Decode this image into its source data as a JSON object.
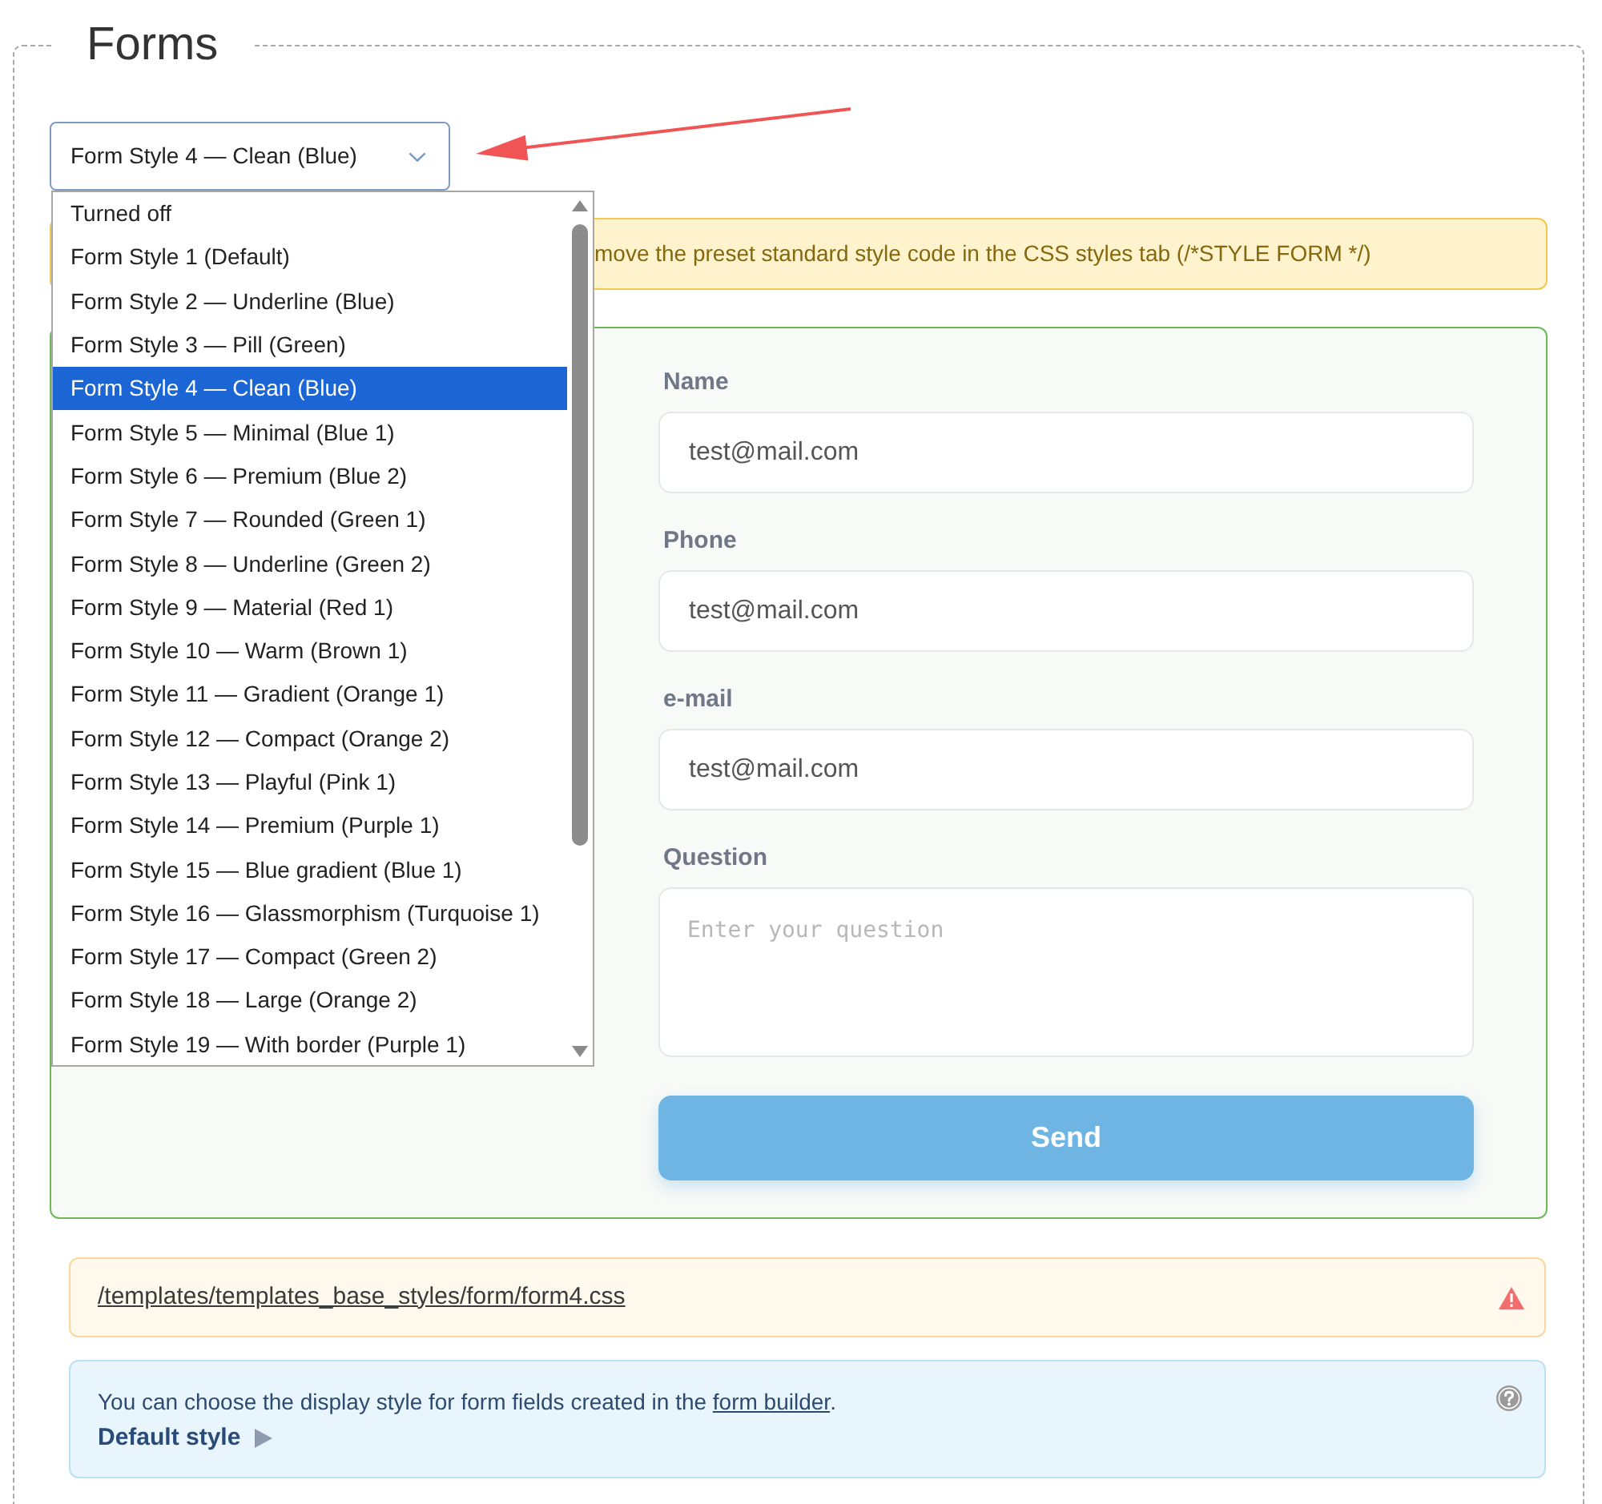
{
  "section": {
    "title": "Forms"
  },
  "style_select": {
    "value": "Form Style 4 — Clean (Blue)",
    "expanded": true
  },
  "style_options": [
    {
      "label": "Turned off",
      "selected": false
    },
    {
      "label": "Form Style 1 (Default)",
      "selected": false
    },
    {
      "label": "Form Style 2 — Underline (Blue)",
      "selected": false
    },
    {
      "label": "Form Style 3 — Pill (Green)",
      "selected": false
    },
    {
      "label": "Form Style 4 — Clean (Blue)",
      "selected": true
    },
    {
      "label": "Form Style 5 — Minimal (Blue 1)",
      "selected": false
    },
    {
      "label": "Form Style 6 — Premium (Blue 2)",
      "selected": false
    },
    {
      "label": "Form Style 7 — Rounded (Green 1)",
      "selected": false
    },
    {
      "label": "Form Style 8 — Underline (Green 2)",
      "selected": false
    },
    {
      "label": "Form Style 9 — Material (Red 1)",
      "selected": false
    },
    {
      "label": "Form Style 10 — Warm (Brown 1)",
      "selected": false
    },
    {
      "label": "Form Style 11 — Gradient (Orange 1)",
      "selected": false
    },
    {
      "label": "Form Style 12 — Compact (Orange 2)",
      "selected": false
    },
    {
      "label": "Form Style 13 — Playful (Pink 1)",
      "selected": false
    },
    {
      "label": "Form Style 14 — Premium (Purple 1)",
      "selected": false
    },
    {
      "label": "Form Style 15 — Blue gradient (Blue 1)",
      "selected": false
    },
    {
      "label": "Form Style 16 — Glassmorphism (Turquoise 1)",
      "selected": false
    },
    {
      "label": "Form Style 17 — Compact (Green 2)",
      "selected": false
    },
    {
      "label": "Form Style 18 — Large (Orange 2)",
      "selected": false
    },
    {
      "label": "Form Style 19 — With border (Purple 1)",
      "selected": false
    }
  ],
  "notice": {
    "text": "move the preset standard style code in the CSS styles tab (/*STYLE FORM */)"
  },
  "preview_form": {
    "fields": [
      {
        "kind": "input",
        "label": "Name",
        "value": "test@mail.com"
      },
      {
        "kind": "input",
        "label": "Phone",
        "value": "test@mail.com"
      },
      {
        "kind": "input",
        "label": "e-mail",
        "value": "test@mail.com"
      },
      {
        "kind": "textarea",
        "label": "Question",
        "placeholder": "Enter your question"
      }
    ],
    "submit": "Send"
  },
  "file_path": {
    "link": "/templates/templates_base_styles/form/form4.css"
  },
  "info": {
    "text_before": "You can choose the display style for form fields created in the ",
    "link": "form builder",
    "text_after": ".",
    "toggle": "Default style",
    "expanded": false
  }
}
